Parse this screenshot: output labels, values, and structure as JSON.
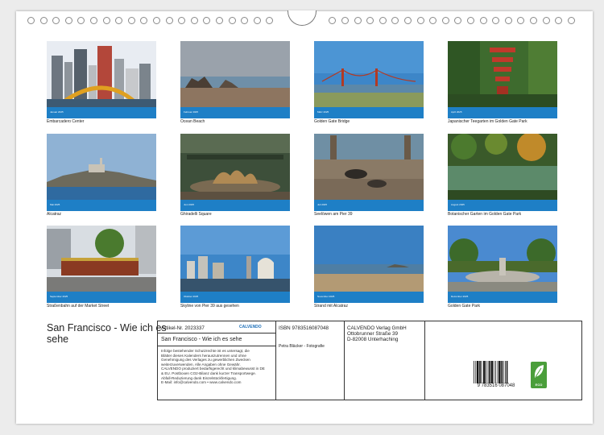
{
  "calendar_title": "San Francisco - Wie ich es sehe",
  "photos": [
    {
      "caption": "Embarcadero Center",
      "month": "Januar 2025"
    },
    {
      "caption": "Ocean Beach",
      "month": "Februar 2025"
    },
    {
      "caption": "Golden Gate Bridge",
      "month": "März 2025"
    },
    {
      "caption": "Japanischer Teegarten im Golden Gate Park",
      "month": "April 2025"
    },
    {
      "caption": "Alcatraz",
      "month": "Mai 2025"
    },
    {
      "caption": "Ghiradelli Square",
      "month": "Juni 2025"
    },
    {
      "caption": "Seelöwen am Pier 39",
      "month": "Juli 2025"
    },
    {
      "caption": "Botanischer Garten im Golden Gate Park",
      "month": "August 2025"
    },
    {
      "caption": "Straßenbahn auf der Market Street",
      "month": "September 2025"
    },
    {
      "caption": "Skyline von Pier 39 aus gesehen",
      "month": "Oktober 2025"
    },
    {
      "caption": "Strand mit Alcatraz",
      "month": "November 2025"
    },
    {
      "caption": "Golden Gate Park",
      "month": "Dezember 2025"
    }
  ],
  "info": {
    "article_no": "Artikel-Nr. 2023337",
    "logo": "CALVENDO",
    "title_line": "San Francisco - Wie ich es sehe",
    "legal": [
      "Infolge bestehender Schutzrechte ist es untersagt, die",
      "Blätter dieses Kalenders herauszutrennen und ohne",
      "Genehmigung des Verlages zu gewerblichen Zwecken",
      "weiterzuverwenden. Alle Angaben ohne Gewähr.",
      "CALVENDO produziert bedarfsgerecht und klimabewusst in DE",
      "& EU. Postboxen CO2-Bilanz dank kurzer Transportwege.",
      "Abfall-Reduzierung dank Einzelstückfertigung.",
      "E-Mail: info@calvendo.com • www.calvendo.com"
    ],
    "isbn": "ISBN 9783516087048",
    "author": "Petra Bläcker - Fotografie",
    "publisher": [
      "CALVENDO Verlag GmbH",
      "Ottobrunner Straße 39",
      "D-82008 Unterhaching"
    ],
    "barcode_number": "9 783516 087048",
    "eco_label": "ECO"
  }
}
